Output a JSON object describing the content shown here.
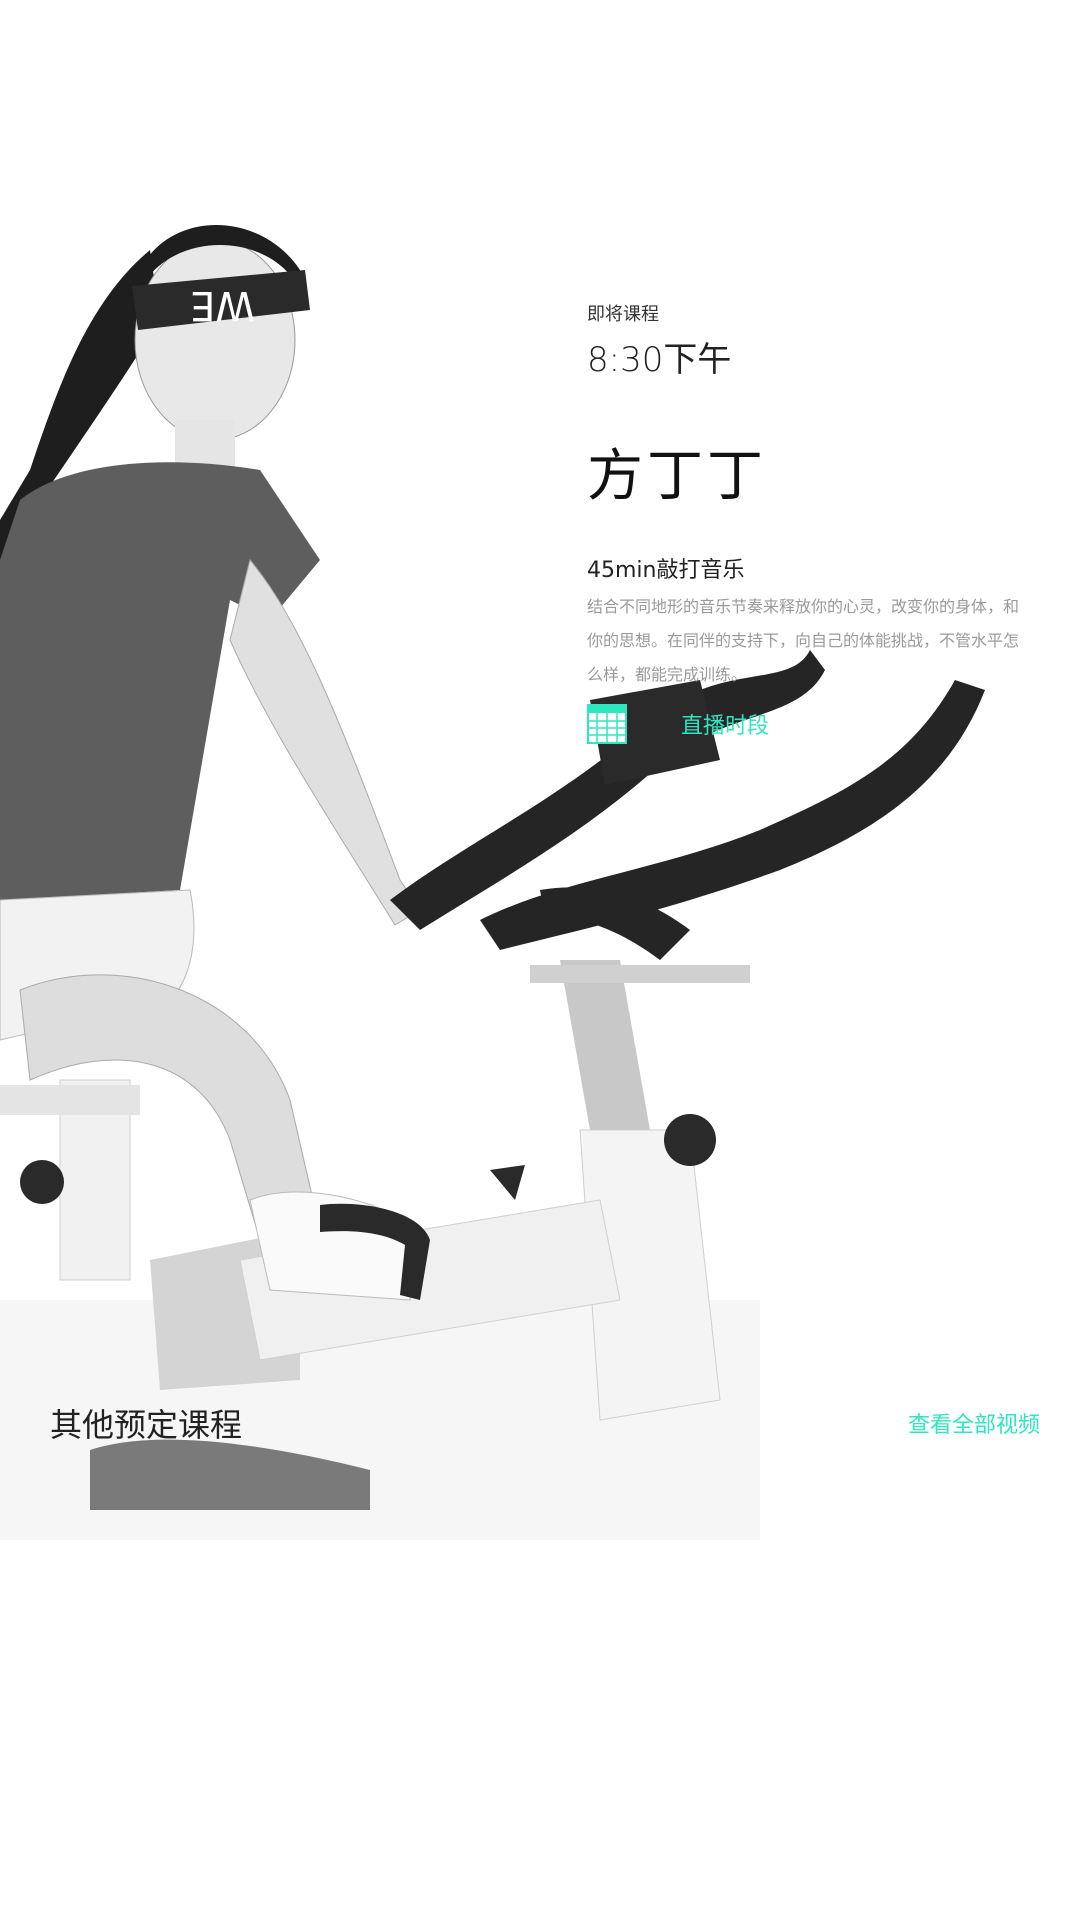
{
  "upcoming": {
    "label": "即将课程",
    "time": "8:30下午",
    "coach": "方丁丁",
    "course_title": "45min敲打音乐",
    "description": "结合不同地形的音乐节奏来释放你的心灵，改变你的身体，和你的思想。在同伴的支持下，向自己的体能挑战，不管水平怎么样，都能完成训练。",
    "live_label": "直播时段"
  },
  "other": {
    "title": "其他预定课程",
    "view_all_label": "查看全部视频"
  },
  "colors": {
    "accent": "#2ee6c0",
    "text": "#222222",
    "muted": "#9a9a9a"
  },
  "icons": {
    "live": "calendar-icon"
  }
}
